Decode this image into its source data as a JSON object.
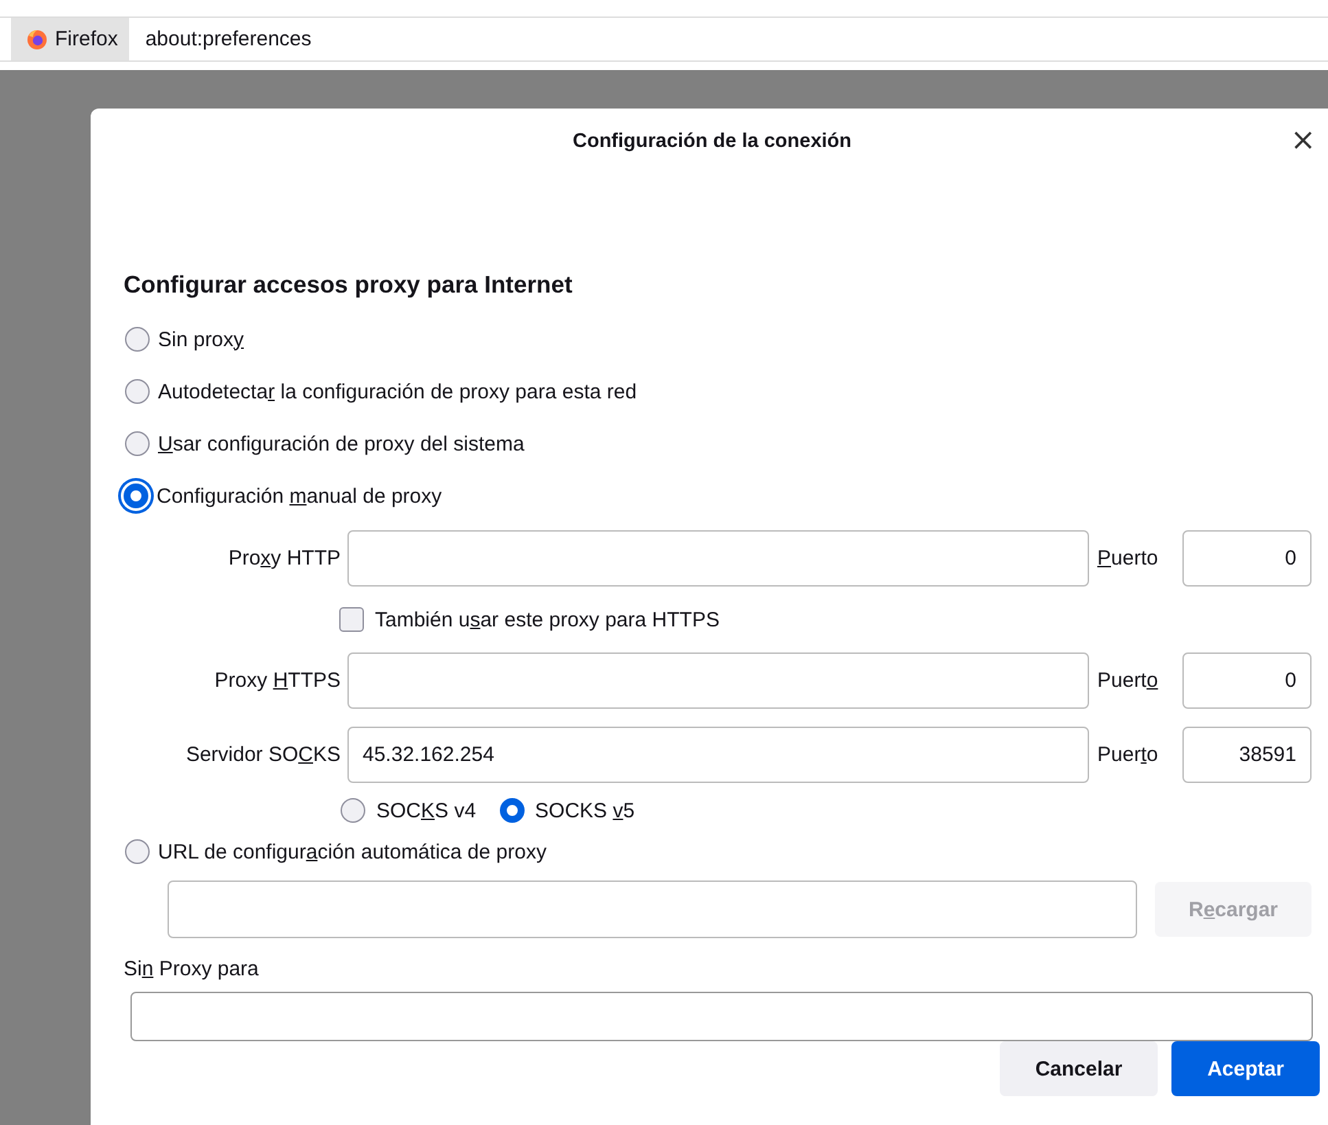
{
  "browser_bar": {
    "app_button": "Firefox",
    "address": "about:preferences"
  },
  "dialog": {
    "title": "Configuración de la conexión",
    "close": "×",
    "heading": "Configurar accesos proxy para Internet",
    "modes": [
      {
        "kind": "plain",
        "label": {
          "pre": "Sin prox",
          "key": "y"
        },
        "selected": false,
        "focused": false
      },
      {
        "kind": "plain",
        "label": {
          "pre": "Autodetecta",
          "key": "r",
          "post": " la configuración de proxy para esta red"
        },
        "selected": false,
        "focused": false
      },
      {
        "kind": "plain",
        "label": {
          "key": "U",
          "post": "sar configuración de proxy del sistema"
        },
        "selected": false,
        "focused": false
      },
      {
        "kind": "manual",
        "label": {
          "pre": "Configuración ",
          "key": "m",
          "post": "anual de proxy"
        },
        "selected": true,
        "focused": true,
        "rows": [
          {
            "kind": "field",
            "label": {
              "pre": "Pro",
              "key": "x",
              "post": "y HTTP"
            },
            "port_label": {
              "key": "P",
              "post": "uerto"
            },
            "port": "0"
          },
          {
            "kind": "checkbox",
            "label": {
              "pre": "También u",
              "key": "s",
              "post": "ar este proxy para HTTPS"
            },
            "checked": false
          },
          {
            "kind": "field",
            "label": {
              "pre": "Proxy ",
              "key": "H",
              "post": "TTPS"
            },
            "port_label": {
              "pre": "Puert",
              "key": "o"
            },
            "port": "0"
          },
          {
            "kind": "field",
            "label": {
              "pre": "Servidor SO",
              "key": "C",
              "post": "KS"
            },
            "value": "45.32.162.254",
            "port_label": {
              "pre": "Puer",
              "key": "t",
              "post": "o"
            },
            "port": "38591"
          },
          {
            "kind": "radios",
            "options": [
              {
                "label": {
                  "pre": "SOC",
                  "key": "K",
                  "post": "S v4"
                },
                "selected": false
              },
              {
                "label": {
                  "pre": "SOCKS ",
                  "key": "v",
                  "post": "5"
                },
                "selected": true
              }
            ]
          }
        ]
      },
      {
        "kind": "pac",
        "label": {
          "pre": "URL de configur",
          "key": "a",
          "post": "ción automática de proxy"
        },
        "selected": false,
        "focused": false,
        "reload_button": {
          "label": {
            "pre": "R",
            "key": "e",
            "post": "cargar"
          },
          "disabled": true
        }
      }
    ],
    "no_proxy_for": {
      "label": {
        "pre": "Si",
        "key": "n",
        "post": " Proxy para"
      }
    },
    "buttons": [
      {
        "kind": "secondary",
        "label": "Cancelar"
      },
      {
        "kind": "primary",
        "label": "Aceptar"
      }
    ]
  }
}
